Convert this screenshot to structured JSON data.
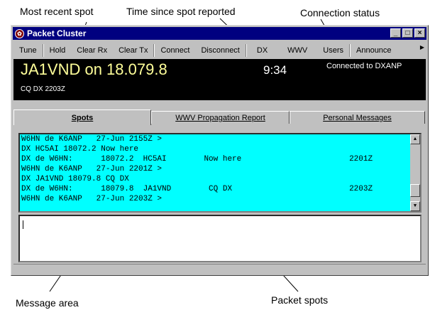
{
  "callouts": {
    "most_recent": "Most recent spot",
    "time_since": "Time since spot reported",
    "connection": "Connection status",
    "message_area": "Message area",
    "packet_spots": "Packet spots"
  },
  "window": {
    "title": "Packet Cluster",
    "min": "_",
    "max": "□",
    "close": "×"
  },
  "toolbar": {
    "tune": "Tune",
    "hold": "Hold",
    "clear_rx": "Clear Rx",
    "clear_tx": "Clear Tx",
    "connect": "Connect",
    "disconnect": "Disconnect",
    "dx": "DX",
    "wwv": "WWV",
    "users": "Users",
    "announce": "Announce"
  },
  "spot": {
    "main": "JA1VND on 18.079.8",
    "time": "9:34",
    "connection": "Connected to DXANP",
    "sub": "CQ DX 2203Z"
  },
  "tabs": {
    "spots": "Spots",
    "wwv": "WWV Propagation Report",
    "personal": "Personal Messages"
  },
  "lines": [
    "W6HN de K6ANP   27-Jun 2155Z >",
    "DX HC5AI 18072.2 Now here",
    "DX de W6HN:      18072.2  HC5AI        Now here                       2201Z",
    "W6HN de K6ANP   27-Jun 2201Z >",
    "DX JA1VND 18079.8 CQ DX",
    "DX de W6HN:      18079.8  JA1VND        CQ DX                         2203Z",
    "W6HN de K6ANP   27-Jun 2203Z >"
  ]
}
